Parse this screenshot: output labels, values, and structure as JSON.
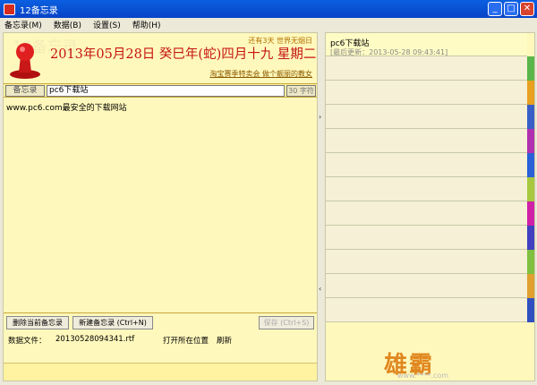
{
  "window": {
    "title": "12备忘录"
  },
  "menu": [
    "备忘录(M)",
    "数据(B)",
    "设置(S)",
    "帮助(H)"
  ],
  "header": {
    "watermark": "12备忘录",
    "date_text": "2013年05月28日 癸巳年(蛇)四月十九 星期二",
    "top_note": "还有3天 世界无烟日",
    "ad_link": "淘宝赛季特卖会 做个靓丽的教女"
  },
  "editor": {
    "category": "备忘录",
    "title": "pc6下载站",
    "char_count": "30 字符",
    "content": "www.pc6.com最安全的下载网站"
  },
  "buttons": {
    "delete": "删除当前备忘录",
    "new": "新建备忘录 (Ctrl+N)",
    "save": "保存 (Ctrl+S)"
  },
  "status": {
    "label": "数据文件：",
    "file": "20130528094341.rtf",
    "open": "打开所在位置",
    "refresh": "刷新"
  },
  "list": {
    "items": [
      {
        "title": "pc6下载站",
        "subtitle": "[最后更新：2013-05-28 09:43:41]"
      }
    ]
  },
  "tab_colors": [
    "#fff8bc",
    "#5ab54a",
    "#e8a020",
    "#3a5ec8",
    "#b030b0",
    "#2a60d8",
    "#a8c840",
    "#d020a8",
    "#4040c0",
    "#80c040",
    "#e0a030",
    "#3050c0"
  ],
  "logo": {
    "text": "雄霸",
    "sub": "www.****.com"
  }
}
